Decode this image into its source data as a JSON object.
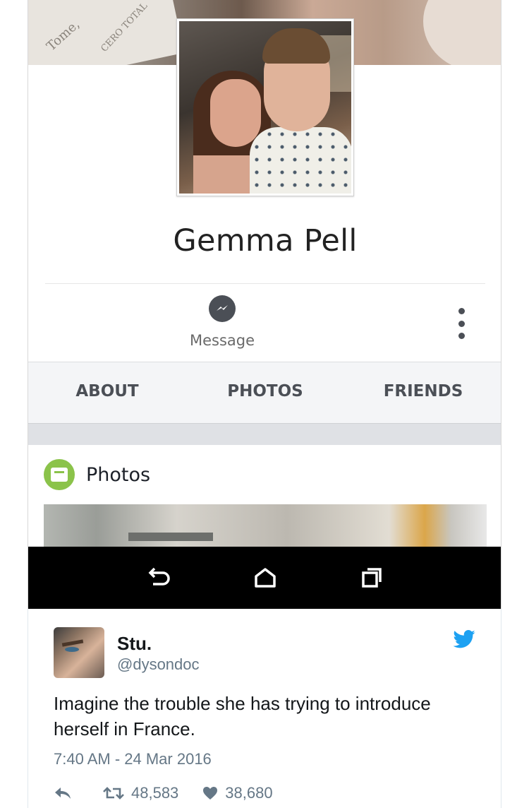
{
  "profile": {
    "name": "Gemma Pell",
    "message_label": "Message",
    "tabs": [
      "ABOUT",
      "PHOTOS",
      "FRIENDS"
    ],
    "photos_section_title": "Photos"
  },
  "cover_text": [
    "Tome,",
    "CERO TOTAL"
  ],
  "tweet": {
    "display_name": "Stu.",
    "handle": "@dysondoc",
    "text": "Imagine the trouble she has trying to introduce herself in France.",
    "timestamp": "7:40 AM - 24 Mar 2016",
    "retweets": "48,583",
    "likes": "38,680"
  },
  "colors": {
    "twitter_blue": "#1da1f2",
    "photos_green": "#8bc34a",
    "tab_bar_bg": "#f4f5f7",
    "icon_dark": "#4b4f56"
  },
  "icons": [
    "messenger-icon",
    "more-vertical-icon",
    "photos-icon",
    "back-icon",
    "home-icon",
    "recents-icon",
    "twitter-bird-icon",
    "reply-icon",
    "retweet-icon",
    "like-icon"
  ]
}
